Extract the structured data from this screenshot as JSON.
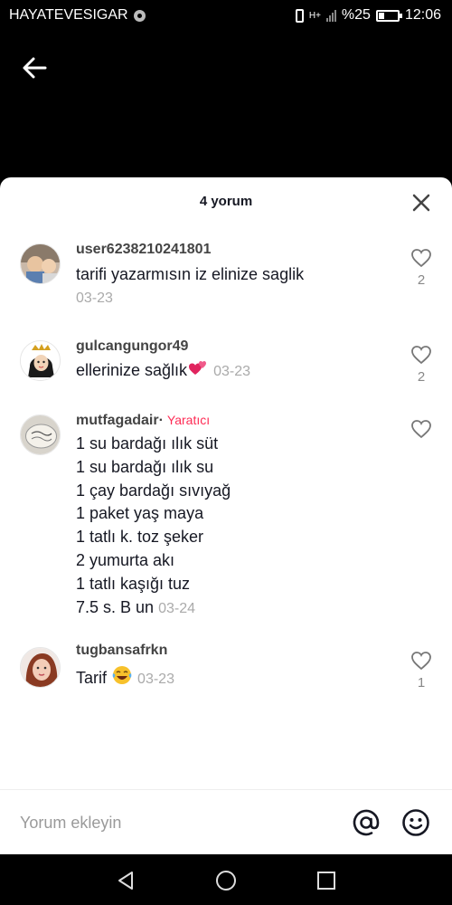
{
  "status_bar": {
    "carrier": "HAYATEVESIGAR",
    "network": "H+",
    "battery": "%25",
    "time": "12:06"
  },
  "sheet": {
    "title": "4 yorum"
  },
  "comments": [
    {
      "username": "user6238210241801",
      "text": "tarifi yazarmısın iz elinize saglik",
      "date": "03-23",
      "likes": "2",
      "avatar": "child-photo-avatar"
    },
    {
      "username": "gulcangungor49",
      "text": "ellerinize sağlık",
      "emoji": "two-hearts-emoji",
      "date": "03-23",
      "likes": "2",
      "avatar": "crowned-girl-avatar"
    },
    {
      "username": "mutfagadair·",
      "badge": "Yaratıcı",
      "lines": [
        "1 su bardağı ılık süt",
        "1 su bardağı ılık su",
        "1 çay bardağı sıvıyağ",
        "1 paket yaş maya",
        "1 tatlı k. toz şeker",
        "2 yumurta akı",
        "1 tatlı kaşığı tuz",
        "7.5 s. B un"
      ],
      "date": "03-24",
      "likes": "",
      "avatar": "kitchen-logo-avatar"
    },
    {
      "username": "tugbansafrkn",
      "text": "Tarif",
      "emoji": "laughing-tears-emoji",
      "date": "03-23",
      "likes": "1",
      "avatar": "woman-photo-avatar"
    }
  ],
  "input": {
    "placeholder": "Yorum ekleyin"
  },
  "colors": {
    "creator_badge": "#fe2c55",
    "username": "#444444",
    "date": "#aaaaaa"
  },
  "icons": [
    "back-arrow-icon",
    "close-icon",
    "heart-outline-icon",
    "at-sign-icon",
    "smiley-icon",
    "nav-back-icon",
    "nav-home-icon",
    "nav-recent-icon"
  ]
}
